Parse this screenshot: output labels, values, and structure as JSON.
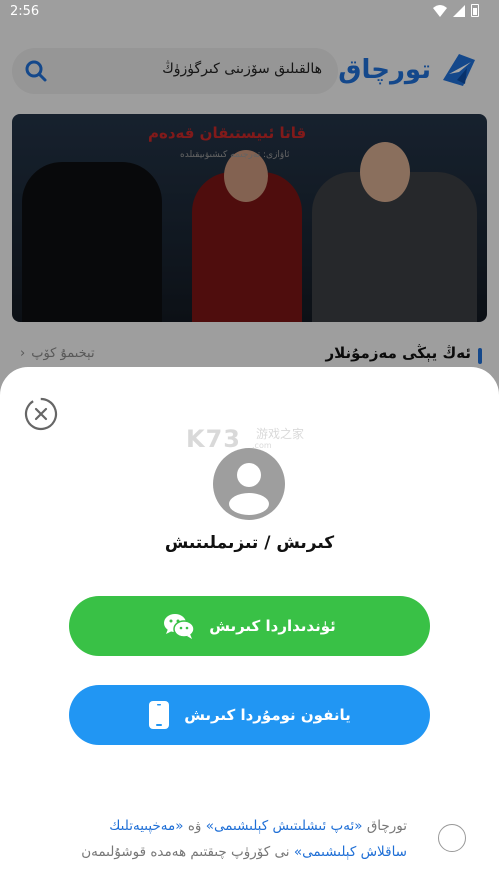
{
  "status_bar": {
    "time": "2:56"
  },
  "header": {
    "search_placeholder": "ھالقىلىق سۆزىنى كىرگۈزۈڭ",
    "logo_text": "تورچاق"
  },
  "banner": {
    "title": "قاتا ئىيستىقان قەدەم",
    "subtitle": "ئاۋازى: تەرجىمە كىشىۋىيقىلدە"
  },
  "section": {
    "title": "ئەڭ يېڭى مەزمۇنلار",
    "more_label": "تېخىمۇ كۆپ",
    "more_chevron": "‹"
  },
  "watermark": {
    "text": "K73",
    "chinese": "游戏之家",
    "url": ".com"
  },
  "login": {
    "title": "كىرىش / تىزىملىتىش",
    "wechat_button": "ئۈندىداردا كىرىش",
    "phone_button": "يانفون نومۇردا كىرىش",
    "agreement_prefix": "تورچاق",
    "agreement_link_1": "«ئەپ ئىشلىتىش كېلىشىمى»",
    "agreement_and": "ۋە",
    "agreement_link_2": "«مەخپىيەتلىك ساقلاش كېلىشىمى»",
    "agreement_suffix": "نى كۆرۈپ چىقتىم ھەمدە قوشۇلىمەن"
  },
  "colors": {
    "brand_blue": "#1f6fd6",
    "wechat_green": "#39c146",
    "phone_blue": "#2196f3"
  },
  "icons": [
    "search-icon",
    "logo-icon",
    "close-icon",
    "avatar-icon",
    "wechat-icon",
    "phone-icon",
    "wifi-icon",
    "signal-icon",
    "battery-icon"
  ]
}
